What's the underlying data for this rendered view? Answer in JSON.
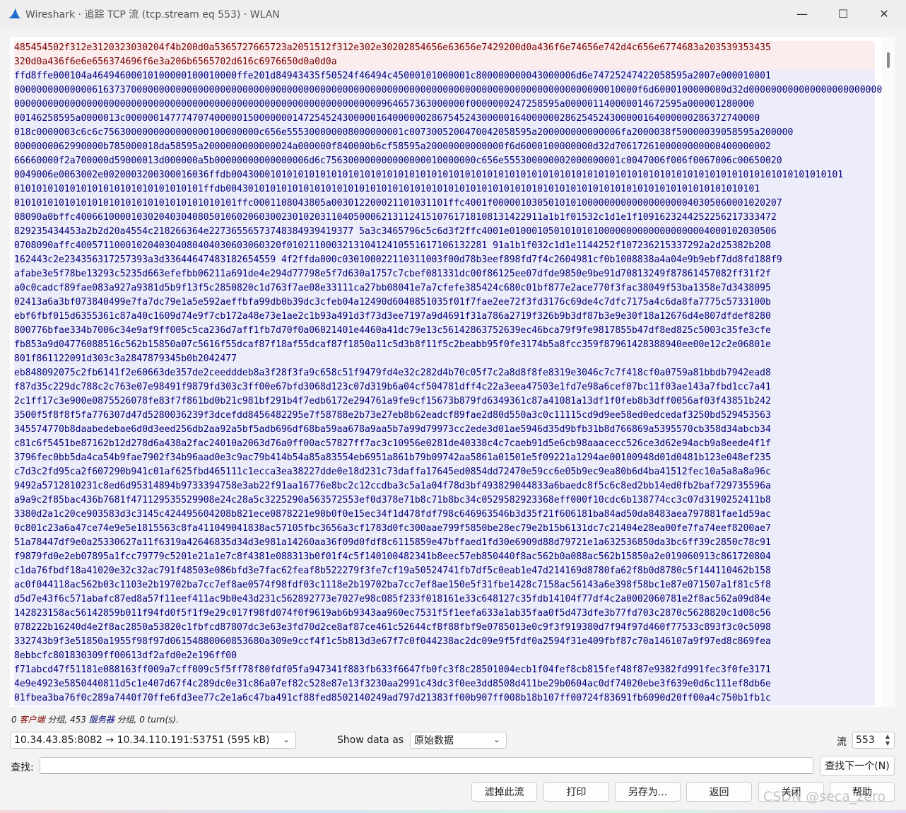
{
  "window": {
    "title": "Wireshark · 追踪 TCP 流 (tcp.stream eq 553) · WLAN",
    "controls": {
      "minimize": "—",
      "maximize": "☐",
      "close": "✕"
    }
  },
  "stream": {
    "lines": [
      {
        "dir": "client",
        "text": "485454502f312e3120323030204f4b200d0a5365727665723a2051512f312e302e30202854656e63656e7429200d0a436f6e74656e742d4c656e6774683a203539353435"
      },
      {
        "dir": "client",
        "text": "320d0a436f6e6e656374696f6e3a206b6565702d616c6976650d0a0d0a"
      },
      {
        "dir": "server",
        "text": "ffd8ffe000104a46494600010100000100010000ffe201d84943435f50524f46494c45000101000001c800000000043000006d6e74725247422058595a2007e000010001"
      },
      {
        "dir": "server",
        "text": "0000000000000061637370000000000000000000000000000000000000000000000000000000000000000000000000000000000000010000f6d6000100000000d32d00000000000000000000000000000000000000000000"
      },
      {
        "dir": "server",
        "text": "000000000000000000000000000000000000000000000000000000000000000000964657363000000f0000000247258595a000001140000014672595a000001280000"
      },
      {
        "dir": "server",
        "text": "00146258595a0000013c000000147774707400000150000000147254524300000164000000286754524300000164000000286254524300000164000000286372740000"
      },
      {
        "dir": "server",
        "text": "018c0000003c6c6c7563000000000000000100000000c656e555300000008000000001c0073005200470042058595a200000000000006fa2000038f50000039058595a200000"
      },
      {
        "dir": "server",
        "text": "0000000062990000b785000018da58595a2000000000000024a000000f840000b6cf58595a20000000000000f6d6000100000000d32d7061726100000000000400000002"
      },
      {
        "dir": "server",
        "text": "66660000f2a700000d59000013d000000a5b00000000000000006d6c756300000000000000010000000c656e555300000002000000001c0047006f006f0067006c00650020"
      },
      {
        "dir": "server",
        "text": "0049006e0063002e0020003200300016036ffdb00430001010101010101010101010101010101010101010101010101010101010101010101010101010101010101010101010101010101"
      },
      {
        "dir": "server",
        "text": "0101010101010101010101010101010101ffdb004301010101010101010101010101010101010101010101010101010101010101010101010101010101010101010101"
      },
      {
        "dir": "server",
        "text": "0101010101010101010101010101010101010101ffc0001108043805a003012200021101031101ffc4001f0000010305010101000000000000000000040305060001020207"
      },
      {
        "dir": "server",
        "text": "08090a0bffc400661000010302040304080501060206030023010203110405000621311241510761718108131422911a1b1f01532c1d1e1f1091623244252256217333472"
      },
      {
        "dir": "server",
        "text": "829235434453a2b2d20a4554c218266364e22736556573748384939419377 5a3c3465796c5c6d3f2ffc4001e010001050101010100000000000000000004000102030506"
      },
      {
        "dir": "server",
        "text": "0708090affc4005711000102040304080404030603060320f010211000321310412410551617106132281 91a1b1f032c1d1e1144252f107236215337292a2d25382b208"
      },
      {
        "dir": "server",
        "text": "162443c2e234356317257393a3d33644647483182654559 4f2ffda000c030100022110311003f00d78b3eef898fd7f4c2604981cf0b1008838a4a04e9b9ebf7dd8fd188f9"
      },
      {
        "dir": "server",
        "text": "afabe3e5f78be13293c5235d663efefbb06211a691de4e294d77798e5f7d630a1757c7cbef081331dc00f86125ee07dfde9850e9be91d70813249f87861457082ff31f2f"
      },
      {
        "dir": "server",
        "text": "a0c0cadcf89fae083a927a9381d5b9f13f5c2850820c1d763f7ae08e33111ca27bb08041e7a7cfefe385424c680c01bf877e2ace770f3fac38049f53ba1358e7d3438095"
      },
      {
        "dir": "server",
        "text": "02413a6a3bf073840499e7fa7dc79e1a5e592aeffbfa99db0b39dc3cfeb04a12490d6040851035f01f7fae2ee72f3fd3176c69de4c7dfc7175a4c6da8fa7775c5733100b"
      },
      {
        "dir": "server",
        "text": "ebf6fbf015d6355361c87a40c1609d74e9f7cb172a48e73e1ae2c1b93a491d3f73d3ee7197a9d4691f31a786a2719f326b9b3df87b3e9e30f18a12676d4e807dfdef8280"
      },
      {
        "dir": "server",
        "text": "800776bfae334b7006c34e9af9ff005c5ca236d7aff1fb7d70f0a06021401e4460a41dc79e13c56142863752639ec46bca79f9fe9817855b47df8ed825c5003c35fe3cfe"
      },
      {
        "dir": "server",
        "text": "fb853a9d04776088516c562b15850a07c5616f55dcaf87f18af55dcaf87f1850a11c5d3b8f11f5c2beabb95f0fe3174b5a8fcc359f87961428388940ee00e12c2e06801e"
      },
      {
        "dir": "server",
        "text": "801f861122091d303c3a2847879345b0b2042477"
      },
      {
        "dir": "server",
        "text": "eb848092075c2fb6141f2e60663de357de2ceedddeb8a3f28f3fa9c658c51f9479fd4e32c282d4b70c05f7c2a8d8f8fe8319e3046c7c7f418cf0a0759a81bbdb7942ead8"
      },
      {
        "dir": "server",
        "text": "f87d35c229dc788c2c763e07e98491f9879fd303c3ff00e67bfd3068d123c07d319b6a04cf504781dff4c22a3eea47503e1fd7e98a6cef07bc11f03ae143a7fbd1cc7a41"
      },
      {
        "dir": "server",
        "text": "2c1ff17c3e900e0875526078fe83f7f861bd0b21c981bf291b4f7edb6172e294761a9fe9cf15673b879fd6349361c87a41081a13df1f0feb8b3dff0056af03f43851b242"
      },
      {
        "dir": "server",
        "text": "3500f5f8f8f5fa776307d47d5280036239f3dcefdd8456482295e7f58788e2b73e27eb8b62eadcf89fae2d80d550a3c0c11115cd9d9ee58ed0edcedaf3250bd529453563"
      },
      {
        "dir": "server",
        "text": "345574770b8daabedebae6d0d3eed256db2aa92a5bf5adb696df68ba59aa678a9aa5b7a99d79973cc2ede3d01ae5946d35d9bfb31b8d766869a5395570cb358d34abcb34"
      },
      {
        "dir": "server",
        "text": "c81c6f5451be87162b12d278d6a438a2fac24010a2063d76a0ff00ac57827ff7ac3c10956e0281de40338c4c7caeb91d5e6cb98aaacecc526ce3d62e94acb9a8eede4f1f"
      },
      {
        "dir": "server",
        "text": "3796fec0bb5da4ca54b9fae7902f34b96aad0e3c9ac79b414b54a85a83554eb6951a861b79b09742aa5861a01501e5f09221a1294ae00100948d01d0481b123e048ef235"
      },
      {
        "dir": "server",
        "text": "c7d3c2fd95ca2f607290b941c01af625fbd465111c1ecca3ea38227dde0e18d231c73daffa17645ed0854dd72470e59cc6e05b9ec9ea80b6d4ba41512fec10a5a8a8a96c"
      },
      {
        "dir": "server",
        "text": "9492a5712810231c8ed6d95314894b9733394758e3ab22f91aa16776e8bc2c12ccdba3c5a1a04f78d3bf493829044833a6baedc8f5c6c8ed2bb14ed0fb2baf729735596a"
      },
      {
        "dir": "server",
        "text": "a9a9c2f85bac436b7681f471129535529908e24c28a5c3225290a563572553ef0d378e71b8c71b8bc34c0529582923368eff000f10cdc6b138774cc3c07d3190252411b8"
      },
      {
        "dir": "server",
        "text": "3380d2a1c20ce903583d3c3145c424495604208b821ece0878221e90b0f0e15ec34f1d478fdf798c646963546b3d35f21f606181ba84ad50da8483aea797881fae1d59ac"
      },
      {
        "dir": "server",
        "text": "0c801c23a6a47ce74e9e5e1815563c8fa411049041838ac57105fbc3656a3cf1783d0fc300aae799f5850be28ec79e2b15b6131dc7c21404e28ea00fe7fa74eef8200ae7"
      },
      {
        "dir": "server",
        "text": "51a78447df9e0a25330627a11f6319a42646835d34d3e981a14260aa36f09d0fdf8c6115859e47bffaed1fd30e6909d88d79721e1a632536850da3bc6ff39c2850c78c91"
      },
      {
        "dir": "server",
        "text": "f9879fd0e2eb07895a1fcc79779c5201e21a1e7c8f4381e088313b0f01f4c5f140100482341b8eec57eb850440f8ac562b0a088ac562b15850a2e019060913c861720804"
      },
      {
        "dir": "server",
        "text": "c1da76fbdf18a41020e32c32ac791f48503e086bfd3e7fac62feaf8b522279f3fe7cf19a50524741fb7df5c0eab1e47d214169d8780fa62f8b0d8780c5f144110462b158"
      },
      {
        "dir": "server",
        "text": "ac0f044118ac562b03c1103e2b19702ba7cc7ef8ae0574f98fdf03c1118e2b19702ba7cc7ef8ae150e5f31fbe1428c7158ac56143a6e398f58bc1e87e071507a1f81c5f8"
      },
      {
        "dir": "server",
        "text": "d5d7e43f6c571abafc87ed8a57f11eef411ac9b0e43d231c562892773e7027e98c085f233f018161e33c648127c35fdb14104f77df4c2a0002060781e2f8ac562a09d84e"
      },
      {
        "dir": "server",
        "text": "142823158ac56142859b011f94fd0f5f1f9e29c017f98fd074f0f9619ab6b9343aa960ec7531f5f1eefa633a1ab35faa0f5d473dfe3b77fd703c2870c5628820c1d08c56"
      },
      {
        "dir": "server",
        "text": "078222b16240d4e2f8ac2850a53820c1fbfcd87807dc3e63e3fd70d2ce8af87ce461c52644cf8f88fbf9e0785013e0c9f3f919380d7f94f97d460f77533c893f3c0c5098"
      },
      {
        "dir": "server",
        "text": "332743b9f3e51850a1955f98f97d06154880060853680a309e9ccf4f1c5b813d3e67f7c0f044238ac2dc09e9f5fdf0a2594f31e409fbf87c70a146107a9f97ed8c869fea"
      },
      {
        "dir": "server",
        "text": "8ebbcfc801830309ff00613df2afd0e2e196ff00"
      },
      {
        "dir": "server",
        "text": "f71abcd47f51181e088163ff009a7cff009c5f5ff78f80fdf05fa947341f883fb633f6647fb0fc3f8c28501004ecb1f04fef8cb815fef48f87e9382fd991fec3f0fe3171"
      },
      {
        "dir": "server",
        "text": "4e9e4923e5850440811d5c1e407d67f4c289dc0e31c86a07ef82c528e87e13f3230aa2991c43dc3f0ee3dd8508d411be29b0604ac0df74020ebe3f639e0d6c111ef8db6e"
      },
      {
        "dir": "server",
        "text": "01fbea3ba76f0c289a7440f70ffe6fd3ee77c2e1a6c47ba491cf88fed8502140249ad797d21383ff00b907ff008b18b107ff00724f83691fb6090d20ff00a4c750b1fb1c"
      }
    ]
  },
  "status": {
    "client_count": "0",
    "client_word": "客户端",
    "sep1": "分组,",
    "server_count": "453",
    "server_word": "服务器",
    "sep2": "分组,",
    "turns": "0 turn(s)."
  },
  "controls": {
    "conversation": "10.34.43.85:8082 → 10.34.110.191:53751 (595 kB)",
    "show_data_label": "Show data as",
    "show_data_value": "原始数据",
    "stream_label": "流",
    "stream_value": "553",
    "find_label": "查找:",
    "find_value": "",
    "find_next": "查找下一个(N)"
  },
  "buttons": {
    "filter_out": "滤掉此流",
    "print": "打印",
    "save_as": "另存为...",
    "back": "返回",
    "close": "关闭",
    "help": "帮助"
  },
  "watermark": "CSDN @seca_zero"
}
